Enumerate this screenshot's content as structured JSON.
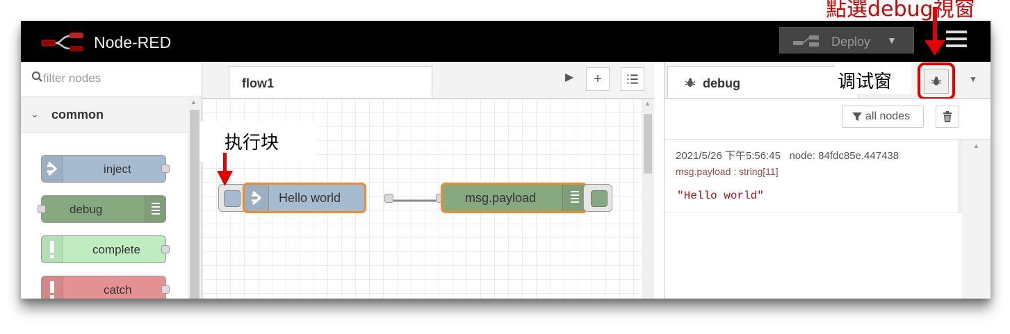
{
  "header": {
    "app_title": "Node-RED",
    "deploy_label": "Deploy"
  },
  "palette": {
    "filter_placeholder": "filter nodes",
    "category": "common",
    "nodes": [
      {
        "label": "inject",
        "color": "#a6bbcf"
      },
      {
        "label": "debug",
        "color": "#87a980"
      },
      {
        "label": "complete",
        "color": "#c0edc0"
      },
      {
        "label": "catch",
        "color": "#e49191"
      }
    ]
  },
  "workspace": {
    "tab_label": "flow1",
    "flow_nodes": [
      {
        "label": "Hello world",
        "type": "inject",
        "color": "#a6bbcf"
      },
      {
        "label": "msg.payload",
        "type": "debug",
        "color": "#87a980"
      }
    ]
  },
  "sidebar": {
    "tab_label": "debug",
    "filter_label": "all nodes",
    "message": {
      "timestamp": "2021/5/26 下午5:56:45",
      "node": "node: 84fdc85e.447438",
      "topic": "msg.payload : string[11]",
      "value": "\"Hello world\""
    }
  },
  "annotations": {
    "exec_block": "执行块",
    "debug_window": "调试窗",
    "top_caption": "點選debug視窗"
  },
  "colors": {
    "accent_red": "#e30000",
    "selection_orange": "#ef8c2b",
    "header_bg": "#000000"
  }
}
